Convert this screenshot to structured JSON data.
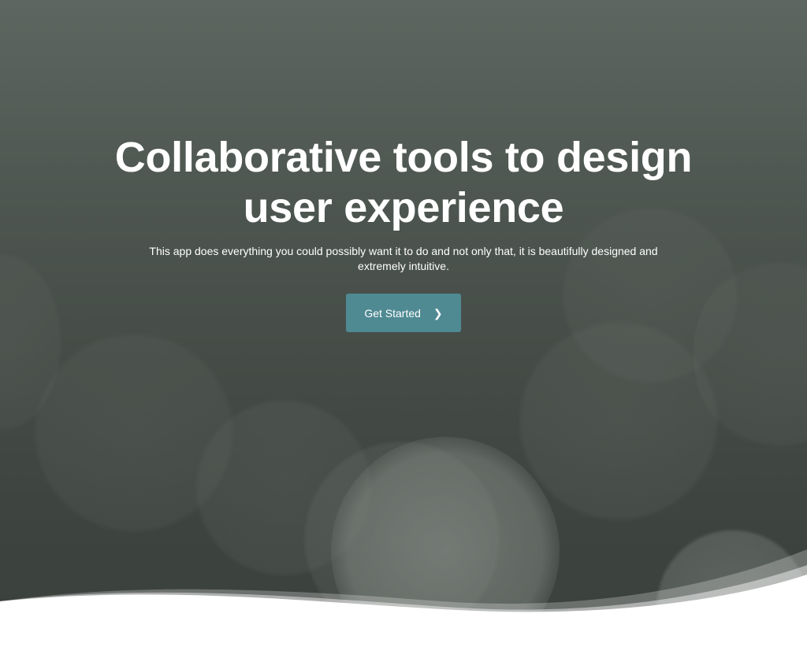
{
  "hero": {
    "headline": "Collaborative tools to design user experience",
    "subtitle": "This app does everything you could possibly want it to do and not only that, it is beautifully designed and extremely intuitive.",
    "cta": {
      "label": "Get Started",
      "icon": "chevron-right-icon",
      "glyph": "❯"
    }
  },
  "colors": {
    "background": "#4a524d",
    "accent": "#4f8a93",
    "text": "#ffffff",
    "wave": "#ffffff"
  }
}
